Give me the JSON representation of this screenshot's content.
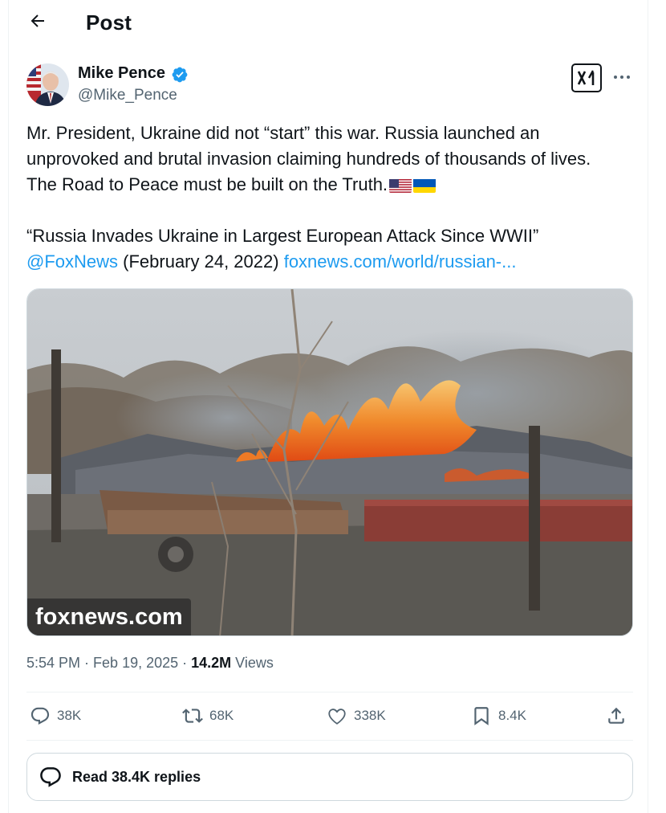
{
  "header": {
    "title": "Post"
  },
  "post": {
    "author": {
      "name": "Mike Pence",
      "handle": "@Mike_Pence",
      "verified": true
    },
    "text": {
      "line1": "Mr. President, Ukraine did not “start” this war. Russia launched an",
      "line2": "unprovoked and brutal invasion claiming hundreds of thousands of lives.",
      "line3": "The Road to Peace must be built on the Truth.",
      "flags": [
        "us-flag-emoji",
        "ukraine-flag-emoji"
      ],
      "quote": "“Russia Invades Ukraine in Largest European Attack Since WWII”",
      "mention": "@FoxNews",
      "date_text": " (February 24, 2022) ",
      "link": "foxnews.com/world/russian-..."
    },
    "media": {
      "watermark": "foxnews.com"
    },
    "meta": {
      "time": "5:54 PM",
      "separator": " · ",
      "date": "Feb 19, 2025",
      "separator2": " · ",
      "views_count": "14.2M",
      "views_label": " Views"
    },
    "actions": {
      "replies": "38K",
      "reposts": "68K",
      "likes": "338K",
      "bookmarks": "8.4K"
    },
    "read_replies_label": "Read 38.4K replies"
  },
  "colors": {
    "link": "#1d9bf0",
    "verified": "#1d9bf0",
    "secondary_text": "#536471",
    "border": "#cfd9de"
  }
}
